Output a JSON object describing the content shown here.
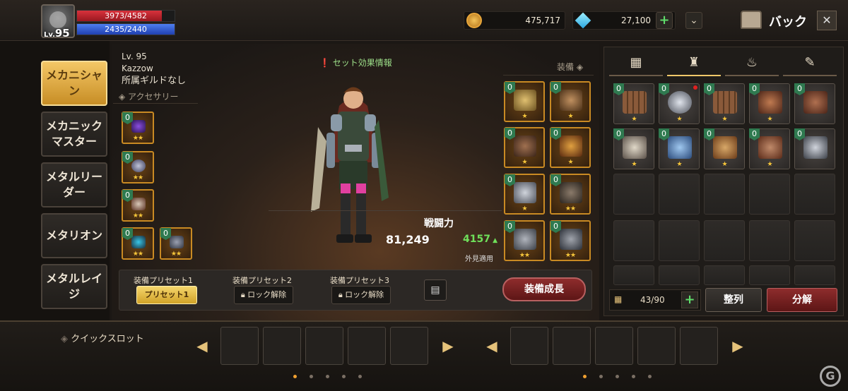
{
  "player": {
    "level_prefix": "Lv.",
    "level": "95",
    "hp": "3973/4582",
    "hp_fraction": 0.867,
    "mp": "2435/2440",
    "mp_fraction": 0.998
  },
  "currency": {
    "gold": "475,717",
    "gems": "27,100"
  },
  "header": {
    "back_label": "バック"
  },
  "jobs": [
    "メカニシャン",
    "メカニックマスター",
    "メタルリーダー",
    "メタリオン",
    "メタルレイジ"
  ],
  "character": {
    "level": "Lv. 95",
    "name": "Kazzow",
    "guild": "所属ギルドなし",
    "accessory_label": "アクセサリー",
    "set_info": "セット効果情報",
    "equip_label": "装備"
  },
  "power": {
    "label": "戦闘力",
    "value": "81,249",
    "bonus": "4157",
    "appearance": "外見適用"
  },
  "presets": [
    {
      "title": "装備プリセット1",
      "button": "プリセット1"
    },
    {
      "title": "装備プリセット2",
      "button": "ロック解除"
    },
    {
      "title": "装備プリセット3",
      "button": "ロック解除"
    }
  ],
  "grow_button": "装備成長",
  "inventory": {
    "capacity": "43/90",
    "sort_label": "整列",
    "disassemble_label": "分解"
  },
  "quickslot": {
    "label": "クイックスロット"
  },
  "badge_value": "0",
  "colors": {
    "accent": "#f0c86a",
    "hp": "#d8323c",
    "mp": "#4e7ef0",
    "danger_button": "#8e2c2c",
    "grade_green": "#2f7a50"
  }
}
